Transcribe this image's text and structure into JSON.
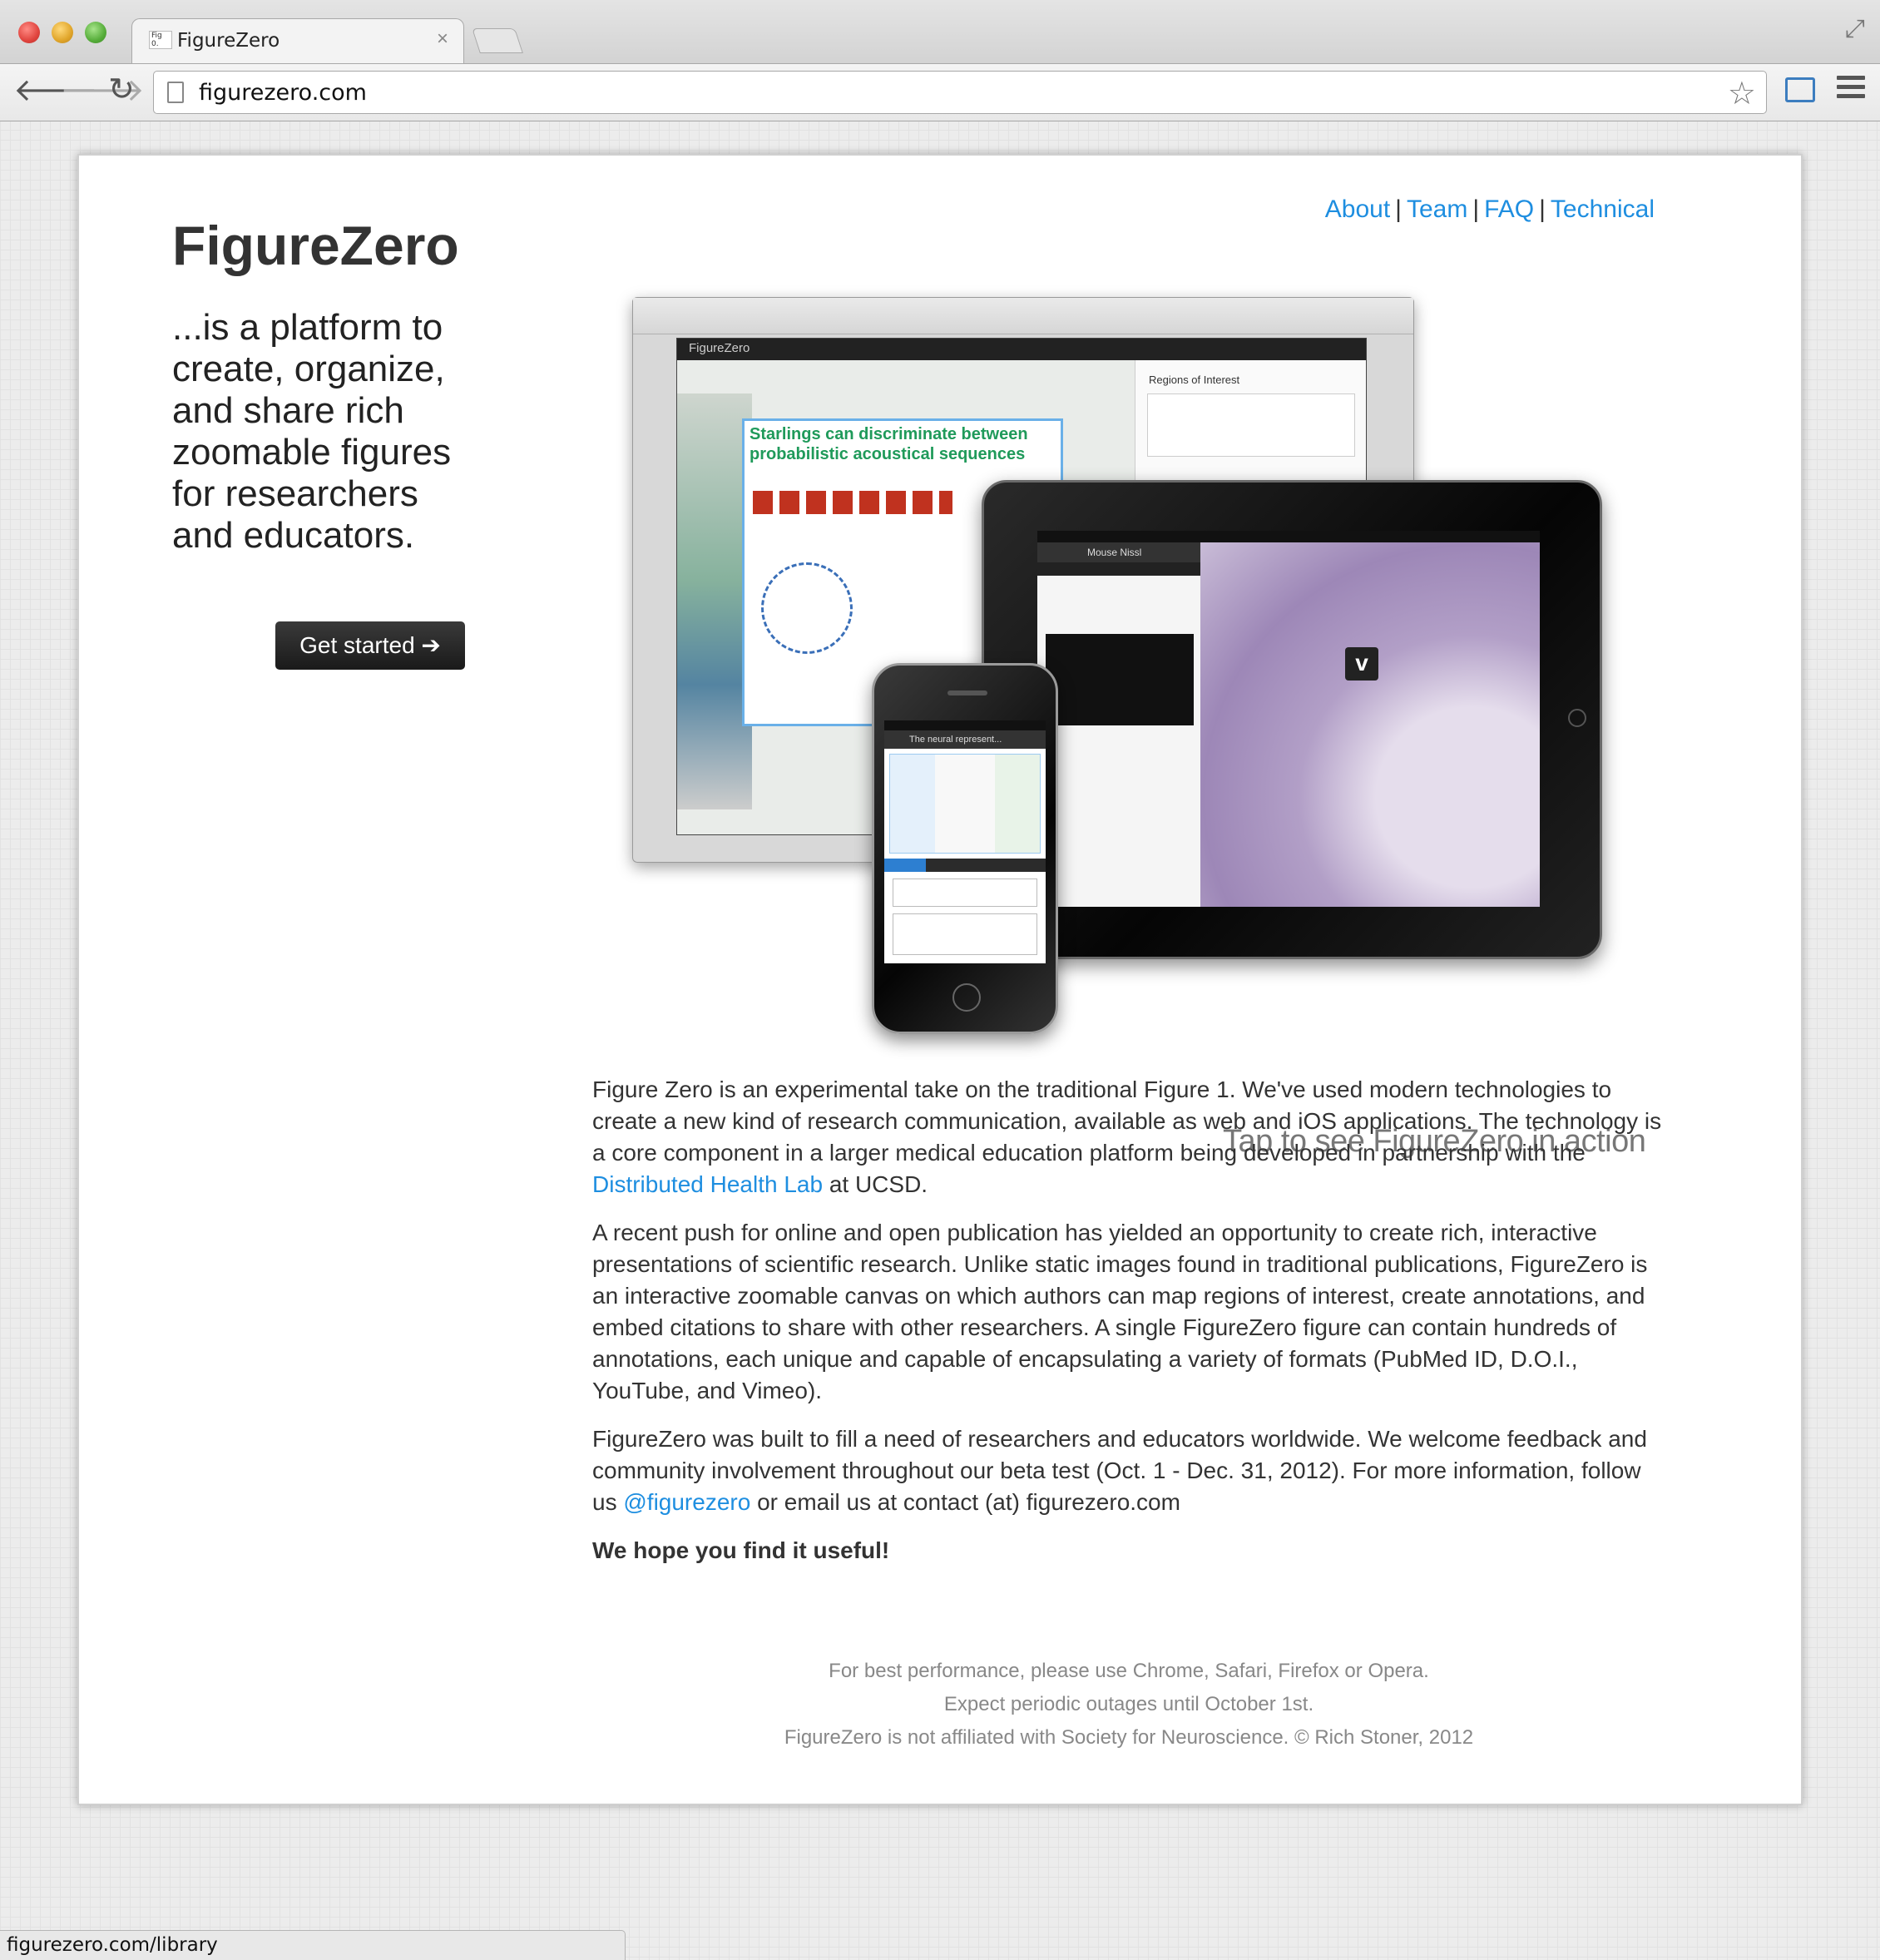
{
  "browser": {
    "tab_title": "FigureZero",
    "tab_favicon_text": "Fig 0.",
    "url": "figurezero.com",
    "status_url": "figurezero.com/library"
  },
  "nav": {
    "links": [
      "About",
      "Team",
      "FAQ",
      "Technical"
    ],
    "separator": "|"
  },
  "hero": {
    "title": "FigureZero",
    "tagline": "...is a platform to create, organize, and share rich zoomable figures for researchers and educators.",
    "cta_label": "Get started ➔",
    "caption": "Tap to see FigureZero in action",
    "screenshot_text": {
      "laptop_app_title": "FigureZero",
      "poster_title": "Starlings can discriminate between probabilistic acoustical sequences",
      "roi_title": "Regions of Interest",
      "tablet_panel_title": "Mouse Nissl",
      "phone_bar_title": "The neural represent..."
    }
  },
  "content": {
    "p1_before": "Figure Zero is an experimental take on the traditional Figure 1. We've used modern technologies to create a new kind of research communication, available as web and iOS applications. The technology is a core component in a larger medical education platform being developed in partnership with the ",
    "p1_link": "Distributed Health Lab",
    "p1_after": " at UCSD.",
    "p2": "A recent push for online and open publication has yielded an opportunity to create rich, interactive presentations of scientific research. Unlike static images found in traditional publications, FigureZero is an interactive zoomable canvas on which authors can map regions of interest, create annotations, and embed citations to share with other researchers. A single FigureZero figure can contain hundreds of annotations, each unique and capable of encapsulating a variety of formats (PubMed ID, D.O.I., YouTube, and Vimeo).",
    "p3_before": "FigureZero was built to fill a need of researchers and educators worldwide. We welcome feedback and community involvement throughout our beta test (Oct. 1 - Dec. 31, 2012). For more information, follow us ",
    "p3_link": "@figurezero",
    "p3_after": " or email us at contact (at) figurezero.com",
    "closing": "We hope you find it useful!"
  },
  "footer": {
    "line1": "For best performance, please use Chrome, Safari, Firefox or Opera.",
    "line2": "Expect periodic outages until October 1st.",
    "line3": "FigureZero is not affiliated with Society for Neuroscience. © Rich Stoner, 2012"
  },
  "icons": {
    "back": "arrow-left-icon",
    "forward": "arrow-right-icon",
    "reload": "reload-icon",
    "bookmark": "star-icon",
    "menu": "hamburger-menu-icon"
  },
  "colors": {
    "link": "#1e8ee0",
    "button_bg": "#222222",
    "body_text": "#333333",
    "footer_text": "#888888"
  }
}
